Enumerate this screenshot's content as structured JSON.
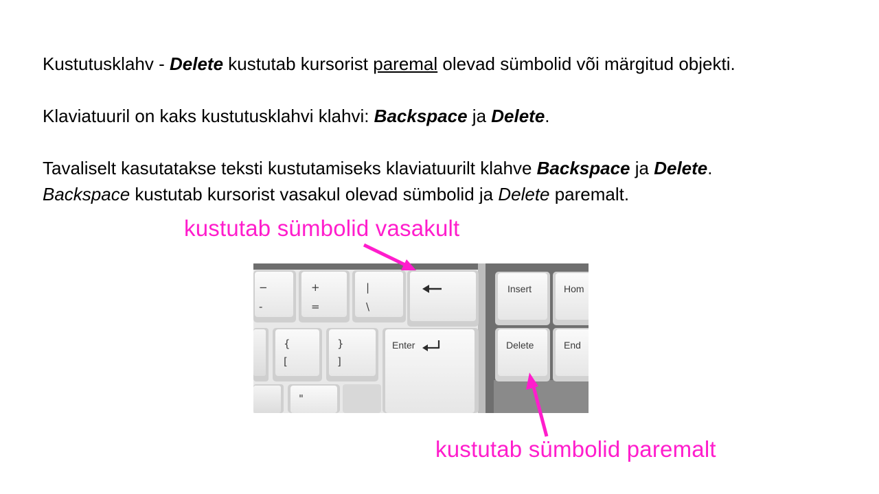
{
  "slide": {
    "paragraphs": {
      "p1": {
        "a": "Kustutusklahv - ",
        "b": "Delete",
        "c": " kustutab kursorist ",
        "d": "paremal",
        "e": " olevad sümbolid või märgitud objekti."
      },
      "p2": {
        "a": "Klaviatuuril on kaks kustutusklahvi klahvi: ",
        "b": "Backspace",
        "c": " ja ",
        "d": "Delete",
        "e": "."
      },
      "p3": {
        "line1": {
          "a": "Tavaliselt kasutatakse teksti kustutamiseks klaviatuurilt klahve ",
          "b": "Backspace",
          "c": " ja ",
          "d": "Delete",
          "e": "."
        },
        "line2": {
          "a": "Backspace",
          "b": " kustutab kursorist vasakul olevad sümbolid ja ",
          "c": "Delete",
          "d": " paremalt."
        }
      }
    }
  },
  "illustration": {
    "label_left": "kustutab sümbolid vasakult",
    "label_right": "kustutab sümbolid paremalt",
    "accent_color": "#ff1dcc",
    "keys": {
      "insert": "Insert",
      "home": "Hom",
      "delete": "Delete",
      "end": "End",
      "enter": "Enter",
      "minus_top": "−",
      "minus_bottom": "-",
      "plus_top": "+",
      "plus_bottom": "=",
      "pipe_top": "|",
      "pipe_bottom": "\\",
      "brace_open_top": "{",
      "brace_open_bottom": "[",
      "brace_close_top": "}",
      "brace_close_bottom": "]",
      "quote": "\""
    }
  }
}
